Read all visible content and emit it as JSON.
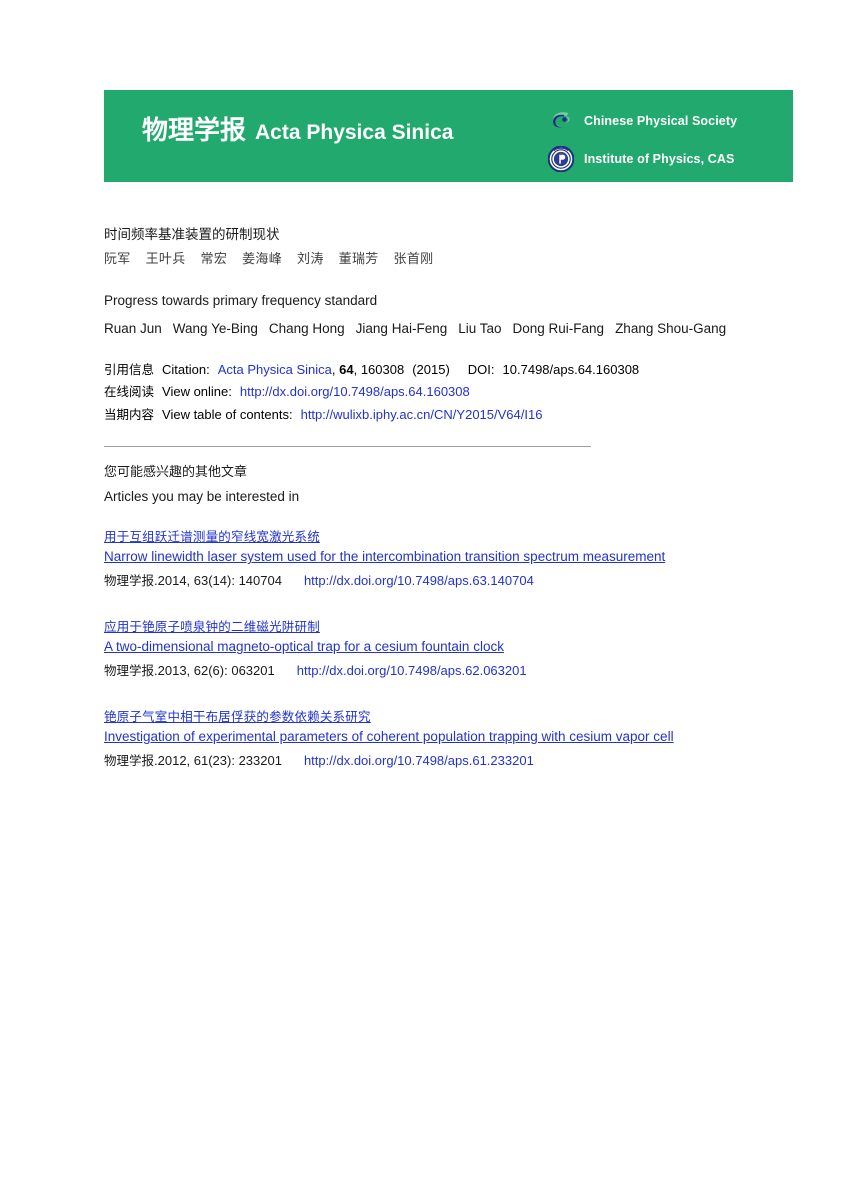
{
  "banner": {
    "journal_cn": "物理学报",
    "journal_en": "Acta Physica Sinica",
    "org1_label": "Chinese Physical Society",
    "org1_icon": "cps-swoosh-logo",
    "org2_label": "Institute of Physics, CAS",
    "org2_icon": "iop-cas-seal-logo",
    "background_color": "#22a96e"
  },
  "article": {
    "title_cn": "时间频率基准装置的研制现状",
    "authors_cn": [
      "阮军",
      "王叶兵",
      "常宏",
      "姜海峰",
      "刘涛",
      "董瑞芳",
      "张首刚"
    ],
    "title_en": "Progress towards primary frequency standard",
    "authors_en": [
      "Ruan Jun",
      "Wang Ye-Bing",
      "Chang Hong",
      "Jiang Hai-Feng",
      "Liu Tao",
      "Dong Rui-Fang",
      "Zhang Shou-Gang"
    ]
  },
  "citation": {
    "line1_label_cn": "引用信息",
    "line1_label_en": "Citation:",
    "journal_link": "Acta Physica Sinica",
    "volume": "64",
    "article_number": "160308",
    "year": "(2015)",
    "doi_label": "DOI:",
    "doi_value": "10.7498/aps.64.160308",
    "line2_label_cn": "在线阅读",
    "line2_label_en": "View online:",
    "line2_url": "http://dx.doi.org/10.7498/aps.64.160308",
    "line3_label_cn": "当期内容",
    "line3_label_en": "View table of contents:",
    "line3_url": "http://wulixb.iphy.ac.cn/CN/Y2015/V64/I16"
  },
  "interested": {
    "heading_cn": "您可能感兴趣的其他文章",
    "heading_en": "Articles you may be interested in"
  },
  "related_articles": [
    {
      "title_cn": "用于互组跃迁谱测量的窄线宽激光系统",
      "title_en": "Narrow linewidth laser system used for the intercombination transition spectrum measurement",
      "journal_cn": "物理学报",
      "meta": ".2014, 63(14): 140704",
      "url": "http://dx.doi.org/10.7498/aps.63.140704"
    },
    {
      "title_cn": "应用于铯原子喷泉钟的二维磁光阱研制",
      "title_en": "A two-dimensional magneto-optical trap for a cesium fountain clock",
      "journal_cn": "物理学报",
      "meta": ".2013, 62(6): 063201",
      "url": "http://dx.doi.org/10.7498/aps.62.063201"
    },
    {
      "title_cn": "铯原子气室中相干布居俘获的参数依赖关系研究",
      "title_en": "Investigation of experimental parameters of coherent population trapping with cesium vapor cell",
      "journal_cn": "物理学报",
      "meta": ".2012, 61(23): 233201",
      "url": "http://dx.doi.org/10.7498/aps.61.233201"
    }
  ],
  "colors": {
    "brand_green": "#22a96e",
    "link_blue": "#2233cc",
    "divider_gray": "#9d9d9d"
  }
}
